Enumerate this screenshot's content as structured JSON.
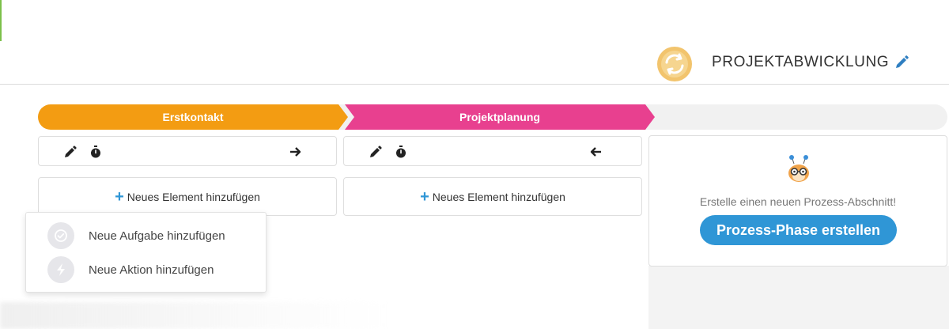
{
  "header": {
    "project_title": "PROJEKTABWICKLUNG"
  },
  "phases": [
    {
      "label": "Erstkontakt",
      "color": "#f39c12"
    },
    {
      "label": "Projektplanung",
      "color": "#e8408f"
    }
  ],
  "columns": [
    {
      "add_label": "Neues Element hinzufügen",
      "arrow": "arrow-right-icon"
    },
    {
      "add_label": "Neues Element hinzufügen",
      "arrow": "arrow-left-icon"
    }
  ],
  "new_phase": {
    "prompt": "Erstelle einen neuen Prozess-Abschnitt!",
    "button_label": "Prozess-Phase erstellen",
    "button_color": "#2f96d6"
  },
  "dropdown": {
    "items": [
      {
        "label": "Neue Aufgabe hinzufügen",
        "icon": "check-circle-icon"
      },
      {
        "label": "Neue Aktion hinzufügen",
        "icon": "lightning-icon"
      }
    ]
  }
}
